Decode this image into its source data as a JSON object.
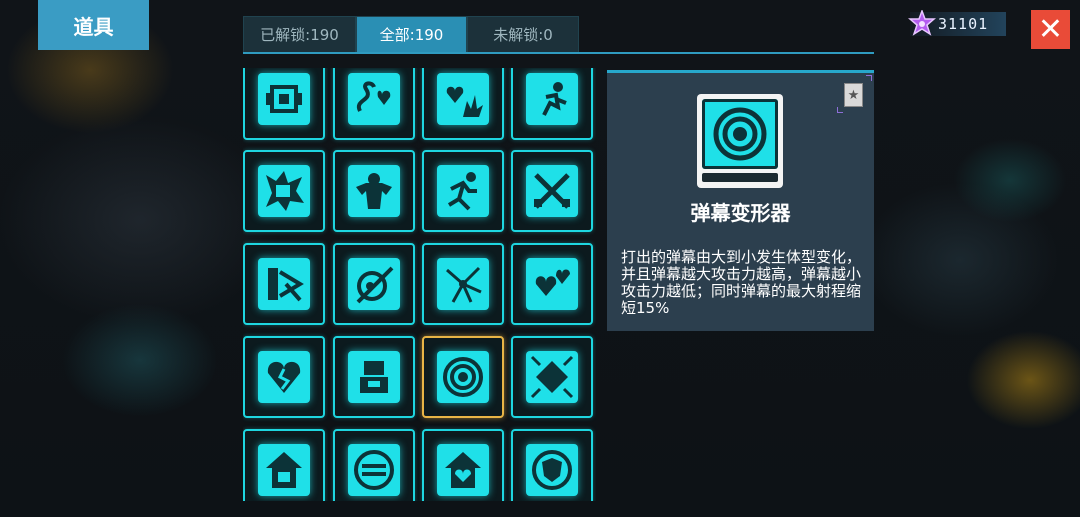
{
  "header": {
    "title": "道具"
  },
  "tabs": [
    {
      "label": "已解锁:190",
      "active": false
    },
    {
      "label": "全部:190",
      "active": true
    },
    {
      "label": "未解锁:0",
      "active": false
    }
  ],
  "currency": {
    "value": "31101",
    "icon": "purple-gem-icon"
  },
  "close": {
    "label": "✕"
  },
  "grid": {
    "items": [
      {
        "icon": "robot-face-icon"
      },
      {
        "icon": "snake-heart-icon"
      },
      {
        "icon": "heart-explosion-icon"
      },
      {
        "icon": "running-man-icon"
      },
      {
        "icon": "fist-burst-icon"
      },
      {
        "icon": "strongman-icon"
      },
      {
        "icon": "sprint-icon"
      },
      {
        "icon": "crossed-swords-icon"
      },
      {
        "icon": "corner-arrows-icon"
      },
      {
        "icon": "ball-slash-icon"
      },
      {
        "icon": "scatter-star-icon"
      },
      {
        "icon": "double-heart-icon"
      },
      {
        "icon": "broken-heart-icon"
      },
      {
        "icon": "mech-fist-icon"
      },
      {
        "icon": "concentric-rings-icon",
        "selected": true
      },
      {
        "icon": "diamond-arrows-icon"
      },
      {
        "icon": "house-boom-icon"
      },
      {
        "icon": "circle-swap-icon"
      },
      {
        "icon": "house-heart-icon"
      },
      {
        "icon": "shield-circle-icon"
      }
    ]
  },
  "detail": {
    "name": "弹幕变形器",
    "description": "打出的弹幕由大到小发生体型变化，并且弹幕越大攻击力越高，弹幕越小攻击力越低；同时弹幕的最大射程缩短15%",
    "icon": "concentric-rings-icon",
    "rank_icon": "star-badge-icon"
  }
}
